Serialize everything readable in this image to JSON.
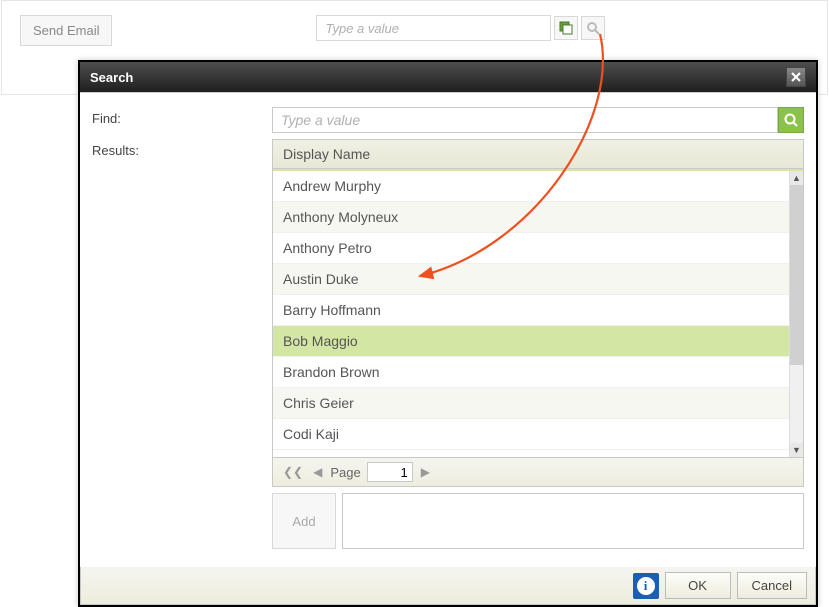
{
  "top": {
    "send_email_label": "Send Email",
    "value_placeholder": "Type a value"
  },
  "dialog": {
    "title": "Search",
    "find_label": "Find:",
    "find_placeholder": "Type a value",
    "results_label": "Results:",
    "column_header": "Display Name",
    "rows": [
      "Andrew Murphy",
      "Anthony Molyneux",
      "Anthony Petro",
      "Austin Duke",
      "Barry Hoffmann",
      "Bob Maggio",
      "Brandon Brown",
      "Chris Geier",
      "Codi Kaji"
    ],
    "selected_index": 5,
    "pager_label": "Page",
    "page_value": "1",
    "add_label": "Add",
    "ok_label": "OK",
    "cancel_label": "Cancel"
  }
}
